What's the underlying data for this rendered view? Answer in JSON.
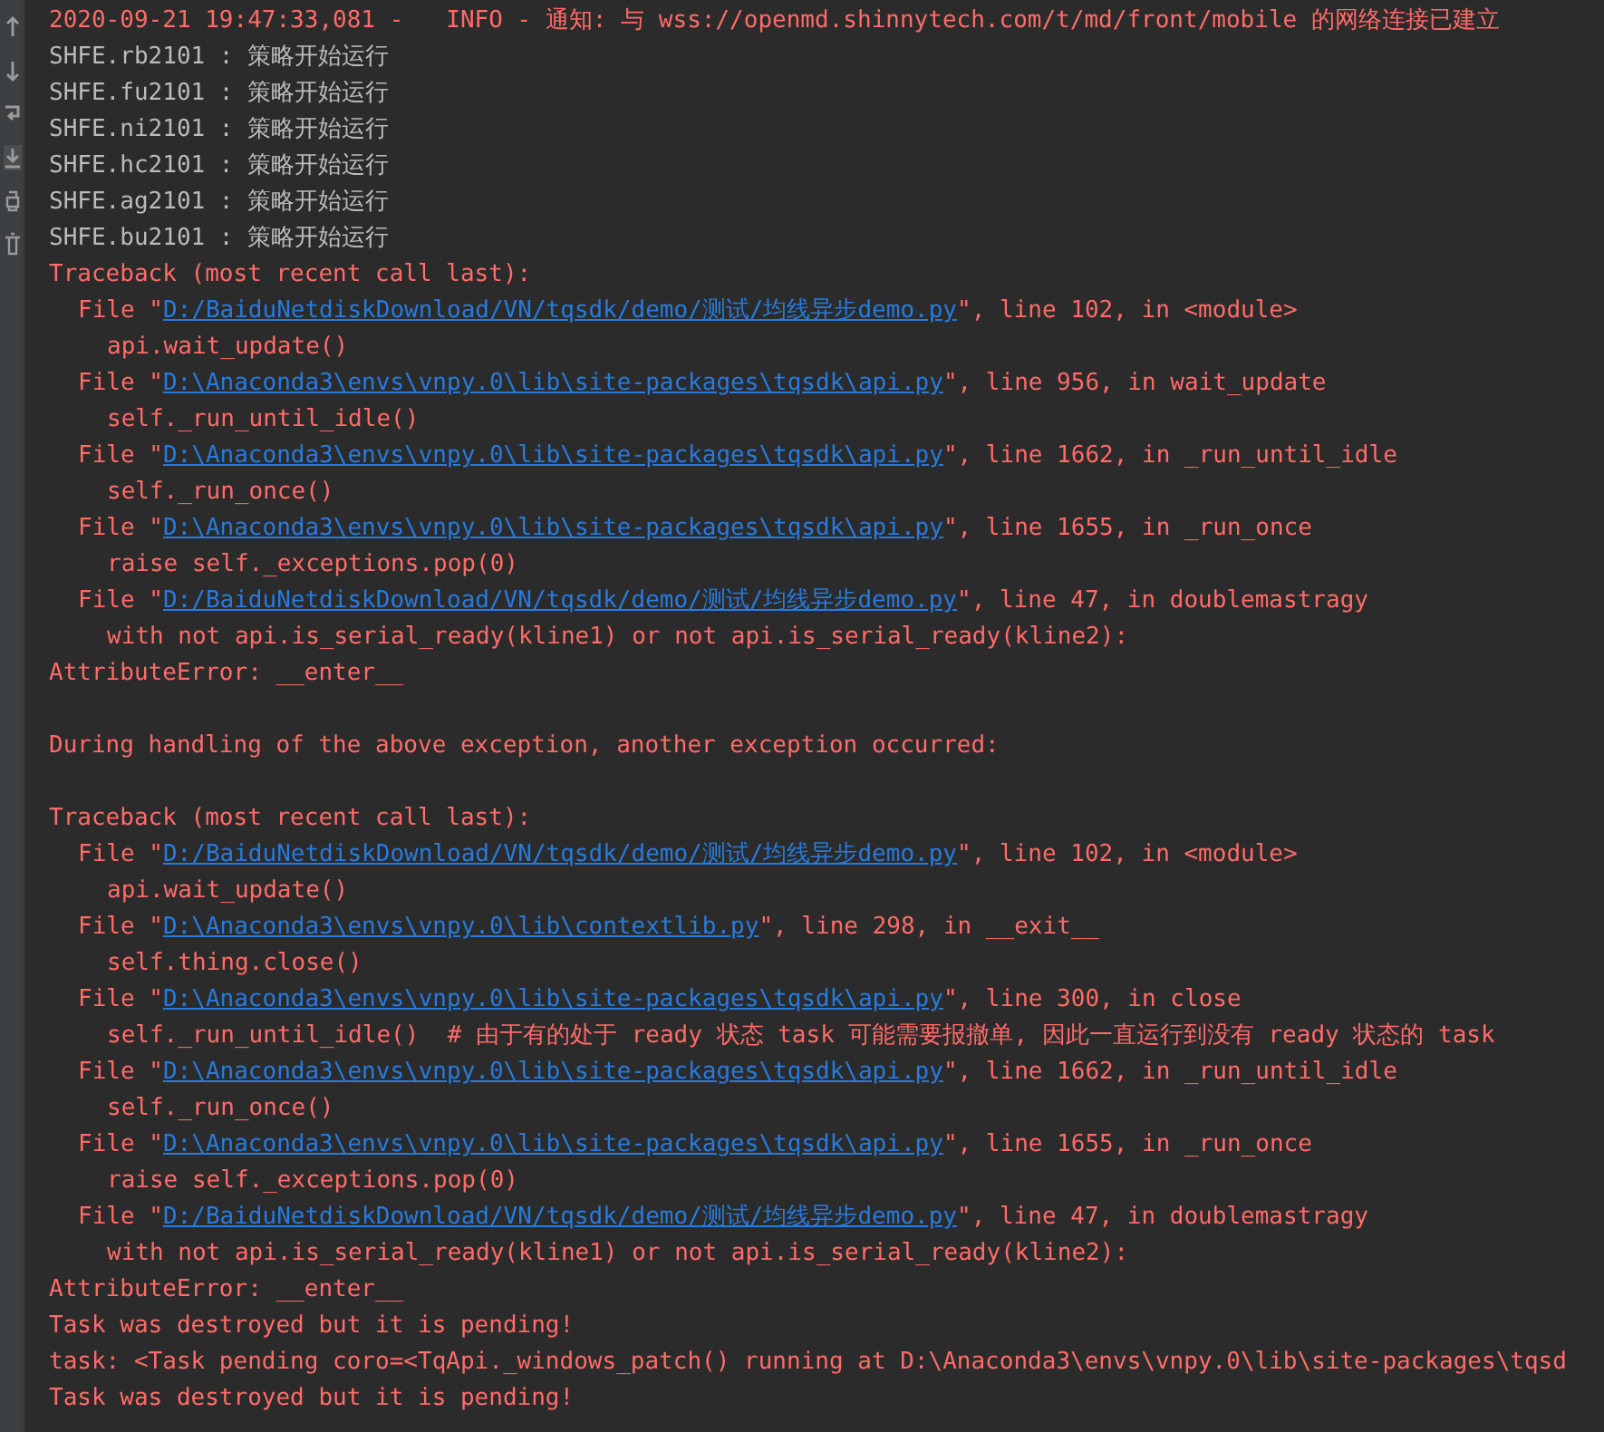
{
  "lines": [
    {
      "kind": "info",
      "text": "2020-09-21 19:47:33,081 -   INFO - 通知: 与 wss://openmd.shinnytech.com/t/md/front/mobile 的网络连接已建立"
    },
    {
      "kind": "plain",
      "text": "SHFE.rb2101 : 策略开始运行"
    },
    {
      "kind": "plain",
      "text": "SHFE.fu2101 : 策略开始运行"
    },
    {
      "kind": "plain",
      "text": "SHFE.ni2101 : 策略开始运行"
    },
    {
      "kind": "plain",
      "text": "SHFE.hc2101 : 策略开始运行"
    },
    {
      "kind": "plain",
      "text": "SHFE.ag2101 : 策略开始运行"
    },
    {
      "kind": "plain",
      "text": "SHFE.bu2101 : 策略开始运行"
    },
    {
      "kind": "error",
      "text": "Traceback (most recent call last):"
    },
    {
      "kind": "file",
      "before": "File \"",
      "link": "D:/BaiduNetdiskDownload/VN/tqsdk/demo/测试/均线异步demo.py",
      "after": "\", line 102, in <module>"
    },
    {
      "kind": "code",
      "text": "api.wait_update()"
    },
    {
      "kind": "file",
      "before": "File \"",
      "link": "D:\\Anaconda3\\envs\\vnpy.0\\lib\\site-packages\\tqsdk\\api.py",
      "after": "\", line 956, in wait_update"
    },
    {
      "kind": "code",
      "text": "self._run_until_idle()"
    },
    {
      "kind": "file",
      "before": "File \"",
      "link": "D:\\Anaconda3\\envs\\vnpy.0\\lib\\site-packages\\tqsdk\\api.py",
      "after": "\", line 1662, in _run_until_idle"
    },
    {
      "kind": "code",
      "text": "self._run_once()"
    },
    {
      "kind": "file",
      "before": "File \"",
      "link": "D:\\Anaconda3\\envs\\vnpy.0\\lib\\site-packages\\tqsdk\\api.py",
      "after": "\", line 1655, in _run_once"
    },
    {
      "kind": "code",
      "text": "raise self._exceptions.pop(0)"
    },
    {
      "kind": "file",
      "before": "File \"",
      "link": "D:/BaiduNetdiskDownload/VN/tqsdk/demo/测试/均线异步demo.py",
      "after": "\", line 47, in doublemastragy"
    },
    {
      "kind": "code",
      "text": "with not api.is_serial_ready(kline1) or not api.is_serial_ready(kline2):"
    },
    {
      "kind": "error",
      "text": "AttributeError: __enter__"
    },
    {
      "kind": "blank"
    },
    {
      "kind": "error",
      "text": "During handling of the above exception, another exception occurred:"
    },
    {
      "kind": "blank"
    },
    {
      "kind": "error",
      "text": "Traceback (most recent call last):"
    },
    {
      "kind": "file",
      "before": "File \"",
      "link": "D:/BaiduNetdiskDownload/VN/tqsdk/demo/测试/均线异步demo.py",
      "after": "\", line 102, in <module>"
    },
    {
      "kind": "code",
      "text": "api.wait_update()"
    },
    {
      "kind": "file",
      "before": "File \"",
      "link": "D:\\Anaconda3\\envs\\vnpy.0\\lib\\contextlib.py",
      "after": "\", line 298, in __exit__"
    },
    {
      "kind": "code",
      "text": "self.thing.close()"
    },
    {
      "kind": "file",
      "before": "File \"",
      "link": "D:\\Anaconda3\\envs\\vnpy.0\\lib\\site-packages\\tqsdk\\api.py",
      "after": "\", line 300, in close"
    },
    {
      "kind": "code",
      "text": "self._run_until_idle()  # 由于有的处于 ready 状态 task 可能需要报撤单, 因此一直运行到没有 ready 状态的 task"
    },
    {
      "kind": "file",
      "before": "File \"",
      "link": "D:\\Anaconda3\\envs\\vnpy.0\\lib\\site-packages\\tqsdk\\api.py",
      "after": "\", line 1662, in _run_until_idle"
    },
    {
      "kind": "code",
      "text": "self._run_once()"
    },
    {
      "kind": "file",
      "before": "File \"",
      "link": "D:\\Anaconda3\\envs\\vnpy.0\\lib\\site-packages\\tqsdk\\api.py",
      "after": "\", line 1655, in _run_once"
    },
    {
      "kind": "code",
      "text": "raise self._exceptions.pop(0)"
    },
    {
      "kind": "file",
      "before": "File \"",
      "link": "D:/BaiduNetdiskDownload/VN/tqsdk/demo/测试/均线异步demo.py",
      "after": "\", line 47, in doublemastragy"
    },
    {
      "kind": "code",
      "text": "with not api.is_serial_ready(kline1) or not api.is_serial_ready(kline2):"
    },
    {
      "kind": "error",
      "text": "AttributeError: __enter__"
    },
    {
      "kind": "error",
      "text": "Task was destroyed but it is pending!"
    },
    {
      "kind": "error",
      "text": "task: <Task pending coro=<TqApi._windows_patch() running at D:\\Anaconda3\\envs\\vnpy.0\\lib\\site-packages\\tqsd"
    },
    {
      "kind": "error",
      "text": "Task was destroyed but it is pending!"
    }
  ]
}
